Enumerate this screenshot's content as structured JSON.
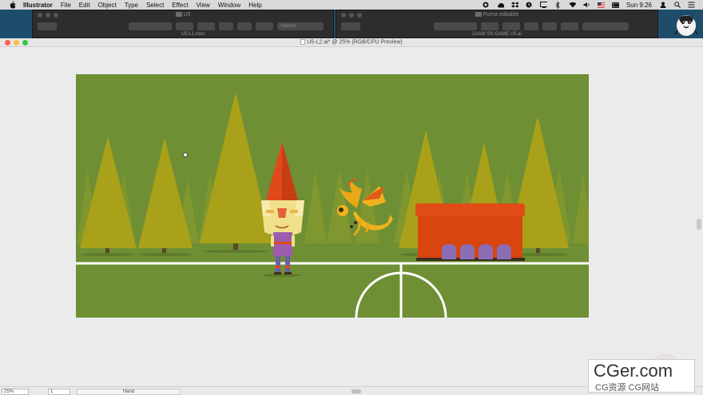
{
  "menubar": {
    "app": "Illustrator",
    "items": [
      "File",
      "Edit",
      "Object",
      "Type",
      "Select",
      "Effect",
      "View",
      "Window",
      "Help"
    ],
    "clock": "Sun 9:26"
  },
  "bg_windows": {
    "left": {
      "title": "U5",
      "file": "U5-L1.mov",
      "search_placeholder": "Search"
    },
    "right": {
      "title": "Puma editable",
      "file": "2AAW SN GAME U5.ai"
    }
  },
  "document": {
    "title": "U5-L2.ai* @ 25% (RGB/CPU Preview)"
  },
  "statusbar": {
    "zoom": "25%",
    "page": "1",
    "tool": "Hand"
  },
  "watermark": {
    "big": "CGer.com",
    "small": "CG资源  CG网站"
  },
  "colors": {
    "field": "#6e8f34",
    "tree": "#a9a119",
    "tree_far": "#8e9a2c",
    "bench": "#e04b16",
    "seat": "#8b6db5"
  }
}
